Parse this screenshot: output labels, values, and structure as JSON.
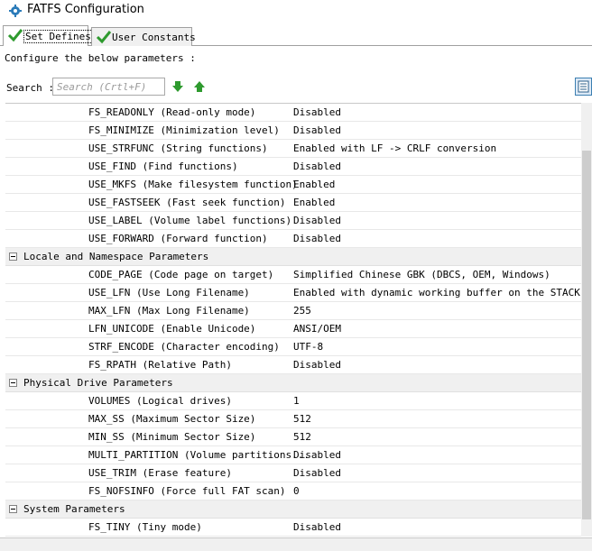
{
  "window": {
    "title": "FATFS Configuration"
  },
  "tabs": [
    {
      "label": "Set Defines",
      "active": true
    },
    {
      "label": "User Constants",
      "active": false
    }
  ],
  "instructions": "Configure the below parameters :",
  "search": {
    "label": "Search :",
    "placeholder": "Search (Crtl+F)"
  },
  "colors": {
    "accent_green": "#2e9a2e",
    "group_bg": "#f0f0f0",
    "icon_blue": "#2b7bb9"
  },
  "rows": [
    {
      "kind": "param",
      "name": "FS_READONLY (Read-only mode)",
      "value": "Disabled"
    },
    {
      "kind": "param",
      "name": "FS_MINIMIZE (Minimization level)",
      "value": "Disabled"
    },
    {
      "kind": "param",
      "name": "USE_STRFUNC (String functions)",
      "value": "Enabled with LF -> CRLF conversion"
    },
    {
      "kind": "param",
      "name": "USE_FIND (Find functions)",
      "value": "Disabled"
    },
    {
      "kind": "param",
      "name": "USE_MKFS (Make filesystem function)",
      "value": "Enabled"
    },
    {
      "kind": "param",
      "name": "USE_FASTSEEK (Fast seek function)",
      "value": "Enabled"
    },
    {
      "kind": "param",
      "name": "USE_LABEL (Volume label functions)",
      "value": "Disabled"
    },
    {
      "kind": "param",
      "name": "USE_FORWARD (Forward function)",
      "value": "Disabled"
    },
    {
      "kind": "group",
      "name": "Locale and Namespace Parameters"
    },
    {
      "kind": "param",
      "name": "CODE_PAGE (Code page on target)",
      "value": "Simplified Chinese GBK (DBCS, OEM, Windows)"
    },
    {
      "kind": "param",
      "name": "USE_LFN (Use Long Filename)",
      "value": "Enabled with dynamic working buffer on the STACK"
    },
    {
      "kind": "param",
      "name": "MAX_LFN (Max Long Filename)",
      "value": "255"
    },
    {
      "kind": "param",
      "name": "LFN_UNICODE (Enable Unicode)",
      "value": "ANSI/OEM"
    },
    {
      "kind": "param",
      "name": "STRF_ENCODE (Character encoding)",
      "value": "UTF-8"
    },
    {
      "kind": "param",
      "name": "FS_RPATH (Relative Path)",
      "value": "Disabled"
    },
    {
      "kind": "group",
      "name": "Physical Drive Parameters"
    },
    {
      "kind": "param",
      "name": "VOLUMES (Logical drives)",
      "value": "1"
    },
    {
      "kind": "param",
      "name": "MAX_SS (Maximum Sector Size)",
      "value": "512"
    },
    {
      "kind": "param",
      "name": "MIN_SS (Minimum Sector Size)",
      "value": "512"
    },
    {
      "kind": "param",
      "name": "MULTI_PARTITION (Volume partitions...",
      "value": "Disabled"
    },
    {
      "kind": "param",
      "name": "USE_TRIM (Erase feature)",
      "value": "Disabled"
    },
    {
      "kind": "param",
      "name": "FS_NOFSINFO (Force full FAT scan)",
      "value": "0"
    },
    {
      "kind": "group",
      "name": "System Parameters"
    },
    {
      "kind": "param",
      "name": "FS_TINY (Tiny mode)",
      "value": "Disabled"
    }
  ]
}
